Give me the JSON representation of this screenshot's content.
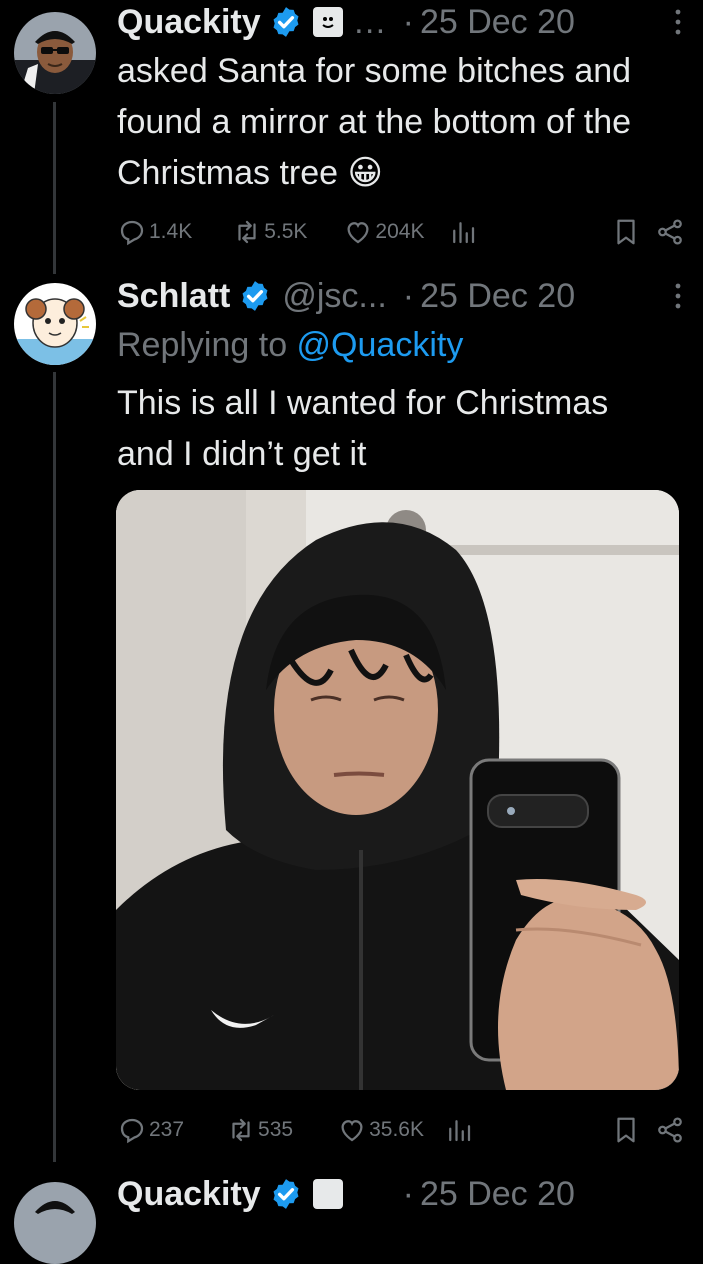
{
  "tweets": [
    {
      "name": "Quackity",
      "handle": "…",
      "date": "25 Dec 20",
      "text": "asked Santa for some bitches and found a mirror at the bottom of the Christmas tree 😀",
      "replies": "1.4K",
      "reposts": "5.5K",
      "likes": "204K"
    },
    {
      "name": "Schlatt",
      "handle": "@jsc...",
      "date": "25 Dec 20",
      "replying_prefix": "Replying to ",
      "replying_mention": "@Quackity",
      "text": "This is all I wanted for Christmas and I didn’t get it",
      "replies": "237",
      "reposts": "535",
      "likes": "35.6K"
    },
    {
      "name": "Quackity",
      "date": "25 Dec 20"
    }
  ],
  "separator": "·",
  "colors": {
    "background": "#000000",
    "primary_text": "#e7e9ea",
    "secondary_text": "#71767b",
    "accent": "#1d9bf0",
    "thread_line": "#333639"
  }
}
